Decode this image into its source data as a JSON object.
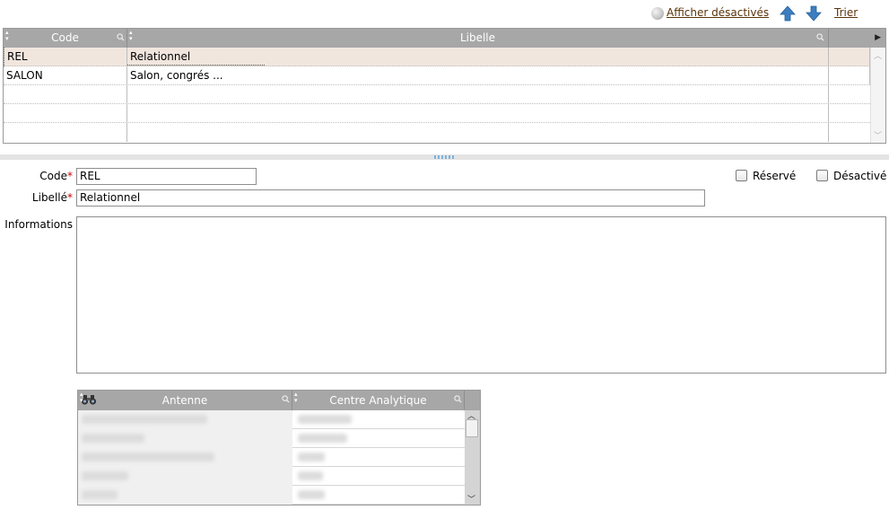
{
  "toolbar": {
    "show_disabled": "Afficher désactivés",
    "sort": "Trier"
  },
  "grid": {
    "columns": [
      "Code",
      "Libelle"
    ],
    "rows": [
      {
        "code": "REL",
        "libelle": "Relationnel"
      },
      {
        "code": "SALON",
        "libelle": "Salon, congrés ..."
      }
    ]
  },
  "form": {
    "code_label": "Code",
    "code_value": "REL",
    "libelle_label": "Libellé",
    "libelle_value": "Relationnel",
    "required_mark": "*",
    "informations_label": "Informations",
    "reserve_label": "Réservé",
    "desactive_label": "Désactivé",
    "reserve_checked": false,
    "desactive_checked": false
  },
  "subgrid": {
    "columns": [
      "Antenne",
      "Centre Analytique"
    ]
  },
  "colors": {
    "header_bg": "#a7a7a7",
    "selected_row": "#f1e6de",
    "link": "#5a3408",
    "arrow_blue": "#3c7fc0",
    "required": "#cc0000"
  }
}
